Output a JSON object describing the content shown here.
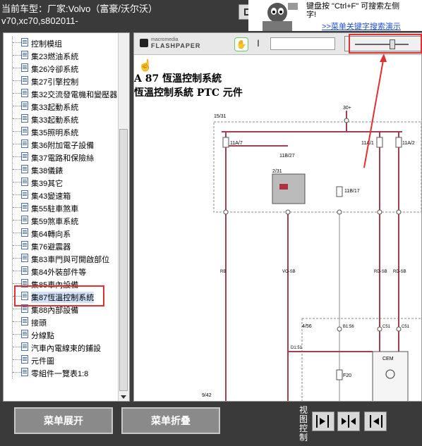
{
  "header": {
    "line1": "当前车型：厂家:Volvo（富豪/沃尔沃）",
    "line2": "v70,xc70,s802011-"
  },
  "ad": {
    "text1": "键盘按 \"Ctrl+F\" 可搜索左侧",
    "text2": "字!",
    "link": ">>菜单关键字搜索演示"
  },
  "sidebar": {
    "items": [
      {
        "label": "控制模组"
      },
      {
        "label": "集23燃油系統"
      },
      {
        "label": "集26冷卻系統"
      },
      {
        "label": "集27引擎控制"
      },
      {
        "label": "集32交流發電機和變壓器"
      },
      {
        "label": "集33起動系統"
      },
      {
        "label": "集33起動系統"
      },
      {
        "label": "集35照明系統"
      },
      {
        "label": "集36附加電子設備"
      },
      {
        "label": "集37電路和保險絲"
      },
      {
        "label": "集38儀錶"
      },
      {
        "label": "集39其它"
      },
      {
        "label": "集43變速箱"
      },
      {
        "label": "集55駐車煞車"
      },
      {
        "label": "集59煞車系統"
      },
      {
        "label": "集64轉向系"
      },
      {
        "label": "集76避震器"
      },
      {
        "label": "集83車門與可開啟部位"
      },
      {
        "label": "集84外裝部件等"
      },
      {
        "label": "集85車內設備"
      },
      {
        "label": "集87恆溫控制系統"
      },
      {
        "label": "集88內部設備"
      },
      {
        "label": "接頭"
      },
      {
        "label": "分線點"
      },
      {
        "label": "汽車內電線束的鋪設"
      },
      {
        "label": "元件圖"
      },
      {
        "label": "零組件一覽表1:8"
      }
    ],
    "selected_index": 20
  },
  "viewer": {
    "logo_top": "macromedia",
    "logo_bottom": "FLASHPAPER",
    "zoom_level": 0.7,
    "doc_title": "A 87 恆溫控制系統",
    "doc_subtitle": "恆溫控制系統 PTC 元件",
    "schematic_labels": {
      "l1531": "15/31",
      "l30": "30+",
      "f1": "11A/7",
      "f2": "11A/1",
      "f3": "11A/2",
      "r1": "11B/27",
      "r2": "2/31",
      "r3": "11B/17",
      "n456": "4/56",
      "cem": "CEM",
      "f20": "F20",
      "l942": "9/42",
      "w1": "RB",
      "w2": "VO-SB",
      "w3": "RD-SB",
      "w4": "RD-SB",
      "c1": "B1:56",
      "c2": "C51",
      "c3": "C51",
      "c4": "D1:51"
    }
  },
  "bottom": {
    "expand_label": "菜单展开",
    "collapse_label": "菜单折叠",
    "view_label": "视图控制"
  }
}
